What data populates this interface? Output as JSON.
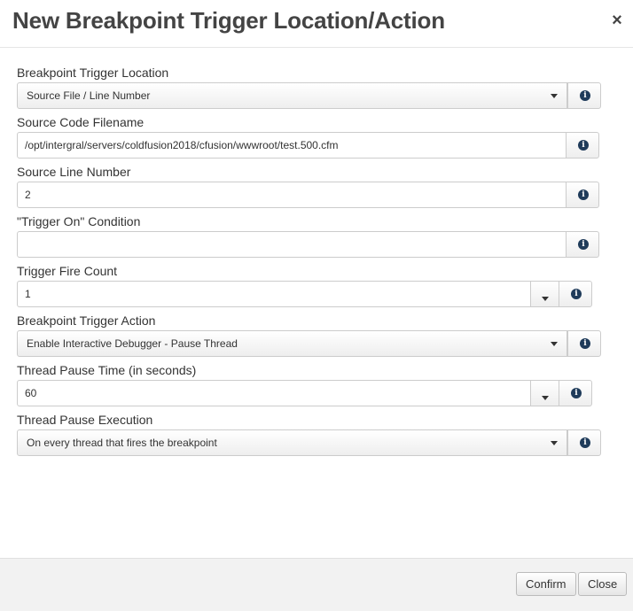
{
  "dialog": {
    "title": "New Breakpoint Trigger Location/Action",
    "close_glyph": "×"
  },
  "fields": {
    "trigger_location": {
      "label": "Breakpoint Trigger Location",
      "value": "Source File / Line Number"
    },
    "source_filename": {
      "label": "Source Code Filename",
      "value": "/opt/intergral/servers/coldfusion2018/cfusion/wwwroot/test.500.cfm"
    },
    "source_line": {
      "label": "Source Line Number",
      "value": "2"
    },
    "trigger_condition": {
      "label": "\"Trigger On\" Condition",
      "value": ""
    },
    "fire_count": {
      "label": "Trigger Fire Count",
      "value": "1"
    },
    "trigger_action": {
      "label": "Breakpoint Trigger Action",
      "value": "Enable Interactive Debugger - Pause Thread"
    },
    "pause_time": {
      "label": "Thread Pause Time (in seconds)",
      "value": "60"
    },
    "pause_execution": {
      "label": "Thread Pause Execution",
      "value": "On every thread that fires the breakpoint"
    }
  },
  "icons": {
    "info": "info-icon",
    "close": "close-icon",
    "caret": "caret-down-icon"
  },
  "info_glyph": "i",
  "footer": {
    "confirm_label": "Confirm",
    "close_label": "Close"
  },
  "colors": {
    "title": "#444444",
    "info_icon": "#1f3b5a",
    "border": "#cccccc",
    "footer_bg": "#f2f2f2"
  }
}
